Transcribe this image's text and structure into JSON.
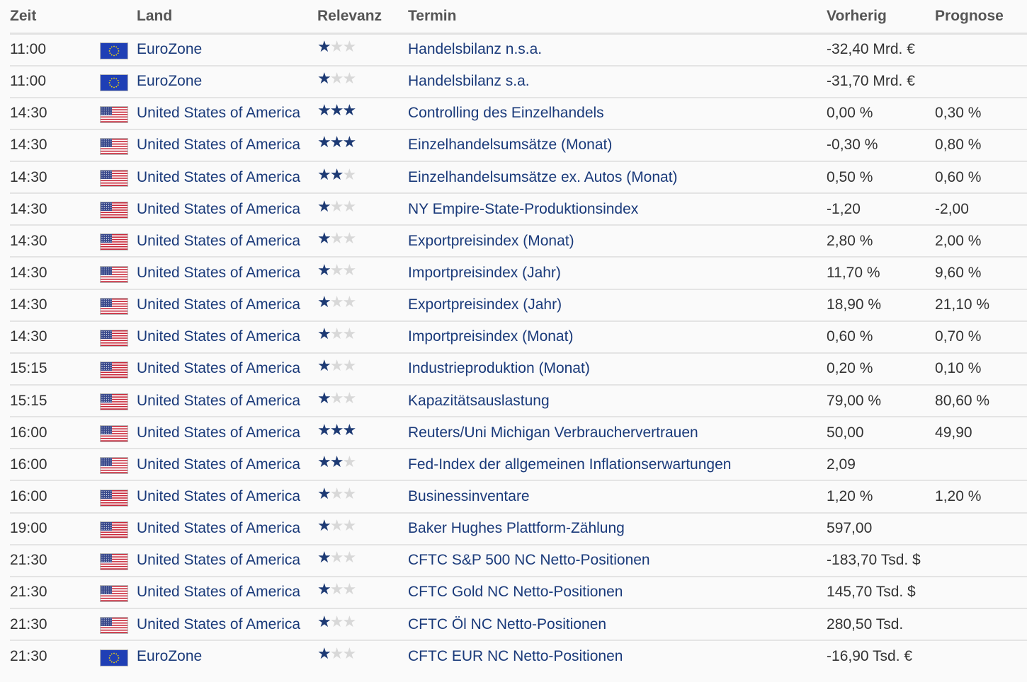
{
  "headers": {
    "time": "Zeit",
    "country": "Land",
    "relevance": "Relevanz",
    "event": "Termin",
    "previous": "Vorherig",
    "forecast": "Prognose"
  },
  "flag_icons": {
    "eu": "eu-flag-icon",
    "us": "us-flag-icon"
  },
  "rows": [
    {
      "time": "11:00",
      "flag": "eu",
      "country": "EuroZone",
      "relevance": 1,
      "event": "Handelsbilanz n.s.a.",
      "previous": "-32,40 Mrd. €",
      "forecast": ""
    },
    {
      "time": "11:00",
      "flag": "eu",
      "country": "EuroZone",
      "relevance": 1,
      "event": "Handelsbilanz s.a.",
      "previous": "-31,70 Mrd. €",
      "forecast": ""
    },
    {
      "time": "14:30",
      "flag": "us",
      "country": "United States of America",
      "relevance": 3,
      "event": "Controlling des Einzelhandels",
      "previous": "0,00 %",
      "forecast": "0,30 %"
    },
    {
      "time": "14:30",
      "flag": "us",
      "country": "United States of America",
      "relevance": 3,
      "event": "Einzelhandelsumsätze (Monat)",
      "previous": "-0,30 %",
      "forecast": "0,80 %"
    },
    {
      "time": "14:30",
      "flag": "us",
      "country": "United States of America",
      "relevance": 2,
      "event": "Einzelhandelsumsätze ex. Autos (Monat)",
      "previous": "0,50 %",
      "forecast": "0,60 %"
    },
    {
      "time": "14:30",
      "flag": "us",
      "country": "United States of America",
      "relevance": 1,
      "event": "NY Empire-State-Produktionsindex",
      "previous": "-1,20",
      "forecast": "-2,00"
    },
    {
      "time": "14:30",
      "flag": "us",
      "country": "United States of America",
      "relevance": 1,
      "event": "Exportpreisindex (Monat)",
      "previous": "2,80 %",
      "forecast": "2,00 %"
    },
    {
      "time": "14:30",
      "flag": "us",
      "country": "United States of America",
      "relevance": 1,
      "event": "Importpreisindex (Jahr)",
      "previous": "11,70 %",
      "forecast": "9,60 %"
    },
    {
      "time": "14:30",
      "flag": "us",
      "country": "United States of America",
      "relevance": 1,
      "event": "Exportpreisindex (Jahr)",
      "previous": "18,90 %",
      "forecast": "21,10 %"
    },
    {
      "time": "14:30",
      "flag": "us",
      "country": "United States of America",
      "relevance": 1,
      "event": "Importpreisindex (Monat)",
      "previous": "0,60 %",
      "forecast": "0,70 %"
    },
    {
      "time": "15:15",
      "flag": "us",
      "country": "United States of America",
      "relevance": 1,
      "event": "Industrieproduktion (Monat)",
      "previous": "0,20 %",
      "forecast": "0,10 %"
    },
    {
      "time": "15:15",
      "flag": "us",
      "country": "United States of America",
      "relevance": 1,
      "event": "Kapazitätsauslastung",
      "previous": "79,00 %",
      "forecast": "80,60 %"
    },
    {
      "time": "16:00",
      "flag": "us",
      "country": "United States of America",
      "relevance": 3,
      "event": "Reuters/Uni Michigan Verbrauchervertrauen",
      "previous": "50,00",
      "forecast": "49,90"
    },
    {
      "time": "16:00",
      "flag": "us",
      "country": "United States of America",
      "relevance": 2,
      "event": "Fed-Index der allgemeinen Inflationserwartungen",
      "previous": "2,09",
      "forecast": ""
    },
    {
      "time": "16:00",
      "flag": "us",
      "country": "United States of America",
      "relevance": 1,
      "event": "Businessinventare",
      "previous": "1,20 %",
      "forecast": "1,20 %"
    },
    {
      "time": "19:00",
      "flag": "us",
      "country": "United States of America",
      "relevance": 1,
      "event": "Baker Hughes Plattform-Zählung",
      "previous": "597,00",
      "forecast": ""
    },
    {
      "time": "21:30",
      "flag": "us",
      "country": "United States of America",
      "relevance": 1,
      "event": "CFTC S&P 500 NC Netto-Positionen",
      "previous": "-183,70 Tsd. $",
      "forecast": ""
    },
    {
      "time": "21:30",
      "flag": "us",
      "country": "United States of America",
      "relevance": 1,
      "event": "CFTC Gold NC Netto-Positionen",
      "previous": "145,70 Tsd. $",
      "forecast": ""
    },
    {
      "time": "21:30",
      "flag": "us",
      "country": "United States of America",
      "relevance": 1,
      "event": "CFTC Öl NC Netto-Positionen",
      "previous": "280,50 Tsd.",
      "forecast": ""
    },
    {
      "time": "21:30",
      "flag": "eu",
      "country": "EuroZone",
      "relevance": 1,
      "event": "CFTC EUR NC Netto-Positionen",
      "previous": "-16,90 Tsd. €",
      "forecast": ""
    }
  ]
}
